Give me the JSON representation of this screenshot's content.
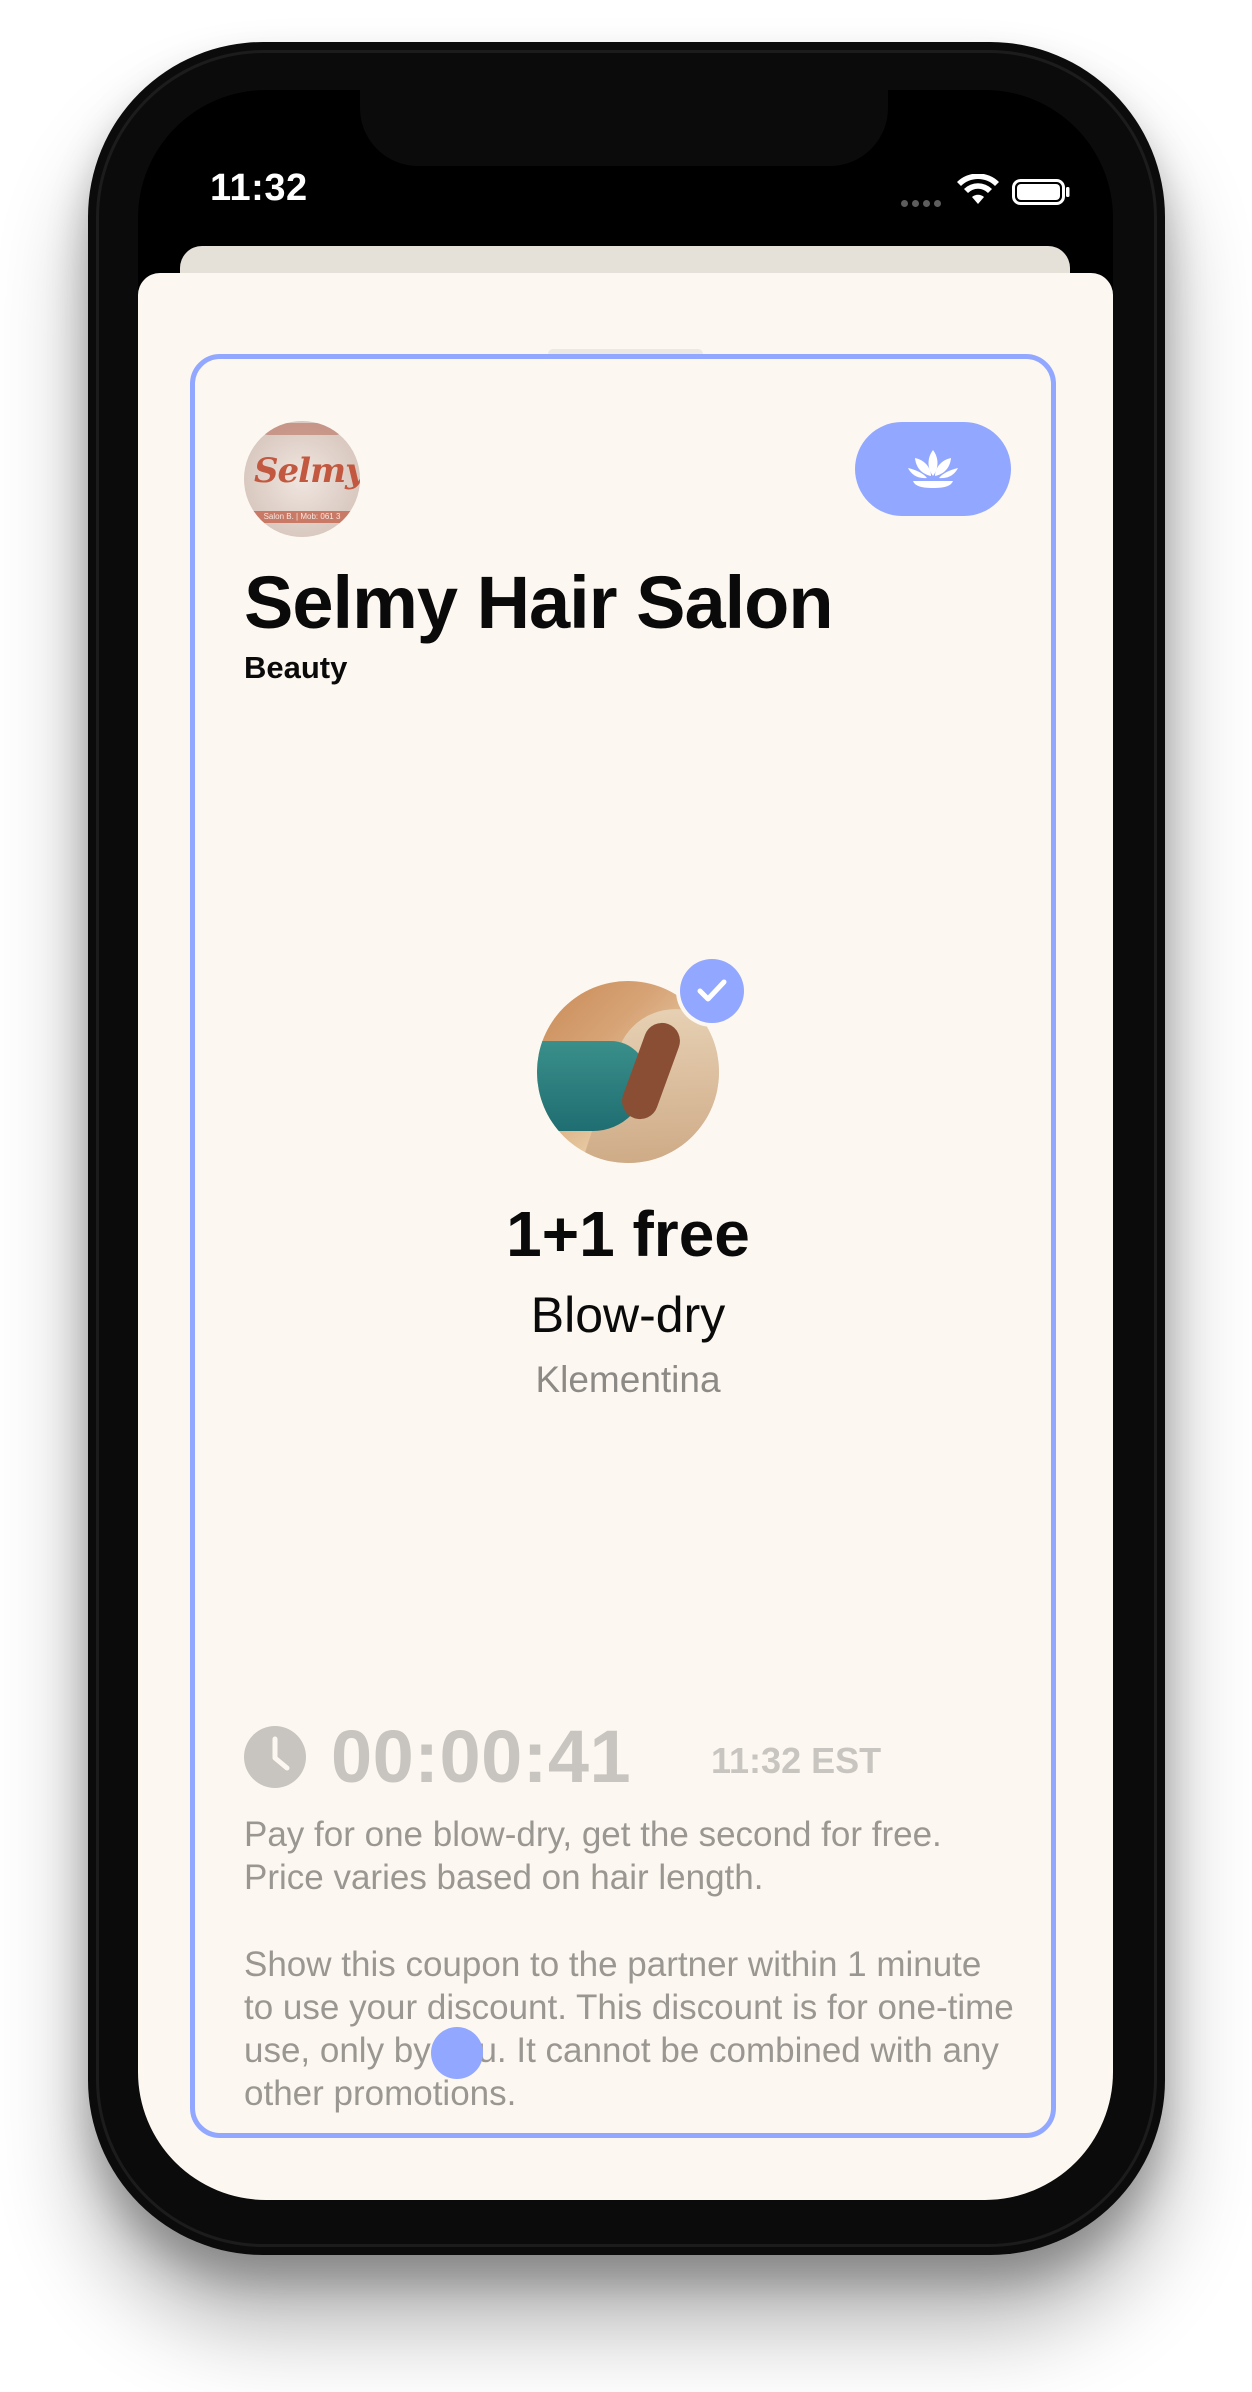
{
  "status_bar": {
    "time": "11:32"
  },
  "business": {
    "name": "Selmy Hair Salon",
    "category": "Beauty",
    "logo_text": "Selmy",
    "logo_strip_text": "Salon B. | Mob: 061 3"
  },
  "category_button": {
    "icon": "lotus-icon"
  },
  "offer": {
    "title": "1+1 free",
    "service": "Blow-dry",
    "owner": "Klementina",
    "verified_icon": "checkmark-icon"
  },
  "countdown": {
    "icon": "clock-icon",
    "timer": "00:00:41",
    "time_zone": "11:32 EST"
  },
  "description": "Pay for one blow-dry, get the second for free. Price varies based on hair length.",
  "terms": "Show this coupon to the partner within 1 minute to use your discount. This discount is for one-time use, only by you. It cannot be combined with any other promotions.",
  "colors": {
    "accent": "#92a7ff",
    "background": "#fcf8f1",
    "muted_text": "#9a9691",
    "timer_text": "#c8c4bf"
  }
}
